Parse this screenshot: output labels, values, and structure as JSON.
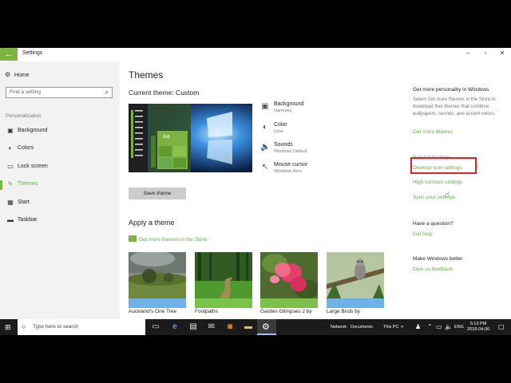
{
  "window": {
    "title": "Settings",
    "back_glyph": "←",
    "controls": [
      "–",
      "▫",
      "✕"
    ]
  },
  "sidebar": {
    "home_label": "Home",
    "search_placeholder": "Find a setting",
    "section_label": "Personalization",
    "items": [
      {
        "label": "Background",
        "icon": "image-icon",
        "glyph": "▣"
      },
      {
        "label": "Colors",
        "icon": "palette-icon",
        "glyph": "◐"
      },
      {
        "label": "Lock screen",
        "icon": "lock-screen-icon",
        "glyph": "▭"
      },
      {
        "label": "Themes",
        "icon": "themes-icon",
        "glyph": "✎"
      },
      {
        "label": "Start",
        "icon": "start-icon",
        "glyph": "▦"
      },
      {
        "label": "Taskbar",
        "icon": "taskbar-icon",
        "glyph": "▬"
      }
    ]
  },
  "main": {
    "title": "Themes",
    "current_theme": "Current theme: Custom",
    "preview_tile_text": "Aa",
    "save_button": "Save theme",
    "options": [
      {
        "label": "Background",
        "sub": "Harmony",
        "icon": "image-icon",
        "glyph": "▣"
      },
      {
        "label": "Color",
        "sub": "Lime",
        "icon": "palette-icon",
        "glyph": "◐"
      },
      {
        "label": "Sounds",
        "sub": "Windows Default",
        "icon": "speaker-icon",
        "glyph": "🔈"
      },
      {
        "label": "Mouse cursor",
        "sub": "Windows Aero",
        "icon": "cursor-icon",
        "glyph": "↖"
      }
    ],
    "apply_title": "Apply a theme",
    "store_link": "Get more themes in the Store",
    "themes": [
      {
        "name": "Auckland's One Tree",
        "bar": "#6fb2ea"
      },
      {
        "name": "Footpaths",
        "bar": "#78c34a"
      },
      {
        "name": "Garden Glimpses 2 by",
        "bar": "#7dc04a"
      },
      {
        "name": "Large Birds by",
        "bar": "#6fb2ea"
      }
    ]
  },
  "right": {
    "personality_title": "Get more personality in Windows",
    "personality_text": "Select Get more themes in the Store to download free themes that combine wallpapers, sounds, and accent colors.",
    "get_more_themes": "Get more themes",
    "related_title": "Related Settings",
    "desktop_icon_settings": "Desktop icon settings",
    "high_contrast": "High contrast settings",
    "sync": "Sync your settings",
    "question_title": "Have a question?",
    "get_help": "Get help",
    "better_title": "Make Windows better",
    "feedback": "Give us feedback"
  },
  "taskbar": {
    "search_text": "Type here to search",
    "network": "Network",
    "documents": "Documents",
    "this_pc": "This PC",
    "lang": "ENG",
    "time": "5:13 PM",
    "date": "2018-04-06"
  },
  "colors": {
    "accent": "#7cb342",
    "highlight_box": "#e0202a"
  }
}
